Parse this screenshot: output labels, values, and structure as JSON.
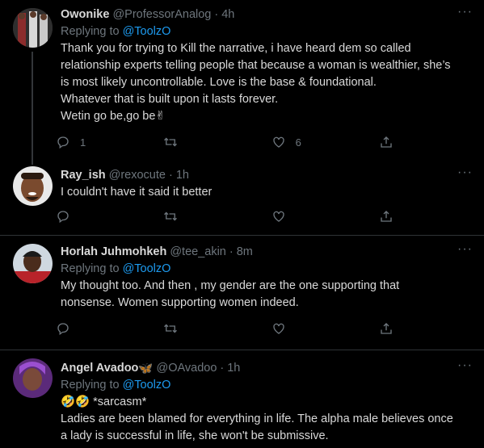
{
  "tweets": [
    {
      "name": "Owonike",
      "handle": "@ProfessorAnalog",
      "time": "4h",
      "replying_prefix": "Replying to",
      "replying_to": "@ToolzO",
      "lines": [
        "Thank you for trying to Kill the narrative, i have heard dem so called",
        "relationship experts telling people that because a woman is wealthier, she’s",
        "is most likely uncontrollable. Love is the base & foundational.",
        "Whatever that is built upon it lasts forever.",
        "Wetin go be,go be✌"
      ],
      "reply_count": "1",
      "retweet_count": "",
      "like_count": "6"
    },
    {
      "name": "Ray_ish",
      "handle": "@rexocute",
      "time": "1h",
      "lines": [
        "I couldn't have it said it better"
      ],
      "reply_count": "",
      "retweet_count": "",
      "like_count": ""
    },
    {
      "name": "Horlah Juhmohkeh",
      "handle": "@tee_akin",
      "time": "8m",
      "replying_prefix": "Replying to",
      "replying_to": "@ToolzO",
      "lines": [
        "My thought too. And then , my gender are the one supporting that",
        "nonsense. Women supporting women indeed."
      ],
      "reply_count": "",
      "retweet_count": "",
      "like_count": ""
    },
    {
      "name": "Angel Avadoo",
      "name_emoji": "🦋",
      "handle": "@OAvadoo",
      "time": "1h",
      "replying_prefix": "Replying to",
      "replying_to": "@ToolzO",
      "lines": [
        "🤣🤣 *sarcasm*",
        "Ladies are been blamed for everything in life. The alpha male believes once",
        "a lady is successful in life, she won't be submissive."
      ]
    }
  ],
  "colors": {
    "background": "#000000",
    "text": "#d9d9d9",
    "muted": "#6e767d",
    "link": "#1d9bf0",
    "divider": "#2f3336"
  },
  "icons": [
    "reply-icon",
    "retweet-icon",
    "like-icon",
    "share-icon",
    "more-icon"
  ]
}
